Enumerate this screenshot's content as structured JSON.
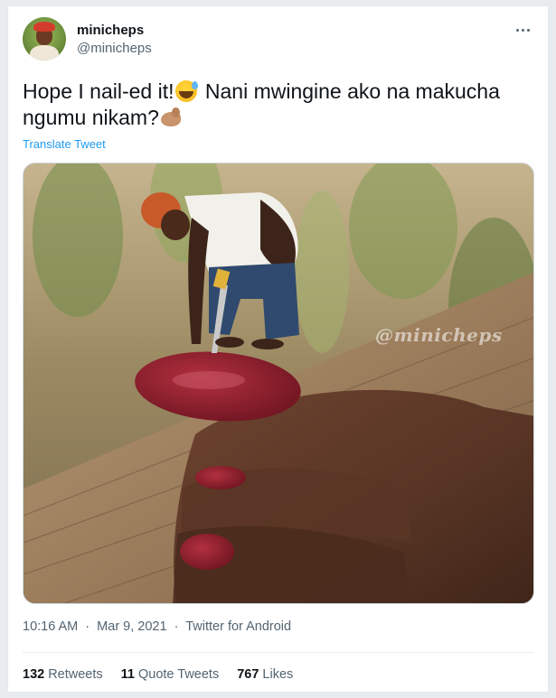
{
  "author": {
    "display_name": "minicheps",
    "handle": "@minicheps"
  },
  "tweet": {
    "text_part1": "Hope I nail-ed it!",
    "text_part2": " Nani mwingine ako na makucha ngumu nikam?",
    "emoji_1": "grinning-face-with-sweat",
    "emoji_2": "flexed-biceps",
    "translate_label": "Translate Tweet"
  },
  "media": {
    "watermark": "@minicheps"
  },
  "meta": {
    "time": "10:16 AM",
    "date": "Mar 9, 2021",
    "source": "Twitter for Android",
    "separator": "·"
  },
  "stats": {
    "retweets_count": "132",
    "retweets_label": "Retweets",
    "quotes_count": "11",
    "quotes_label": "Quote Tweets",
    "likes_count": "767",
    "likes_label": "Likes"
  },
  "colors": {
    "link": "#1d9bf0",
    "secondary_text": "#536471",
    "primary_text": "#0f1419"
  }
}
